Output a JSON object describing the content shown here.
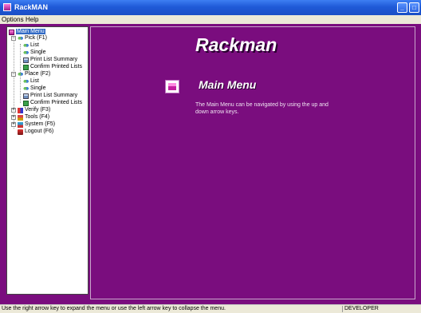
{
  "window": {
    "title": "RackMAN"
  },
  "menubar": {
    "options": "Options",
    "help": "Help"
  },
  "tree": {
    "root": "Main Menu",
    "items": [
      {
        "label": "Pick (F1)",
        "children": [
          "List",
          "Single",
          "Print List Summary",
          "Confirm Printed Lists"
        ]
      },
      {
        "label": "Place (F2)",
        "children": [
          "List",
          "Single",
          "Print List Summary",
          "Confirm Printed Lists"
        ]
      },
      {
        "label": "Verify (F3)"
      },
      {
        "label": "Tools (F4)"
      },
      {
        "label": "System (F5)"
      },
      {
        "label": "Logout (F6)"
      }
    ]
  },
  "main": {
    "app_title": "Rackman",
    "heading": "Main Menu",
    "description": "The Main Menu can be navigated by using the up and down arrow keys."
  },
  "status": {
    "message": "Use the right arrow key to expand the menu or use the left arrow key to collapse the menu.",
    "user": "DEVELOPER"
  },
  "colors": {
    "background": "#7a0d7e",
    "titlebar": "#1f5ad8",
    "selection": "#316ac5"
  }
}
